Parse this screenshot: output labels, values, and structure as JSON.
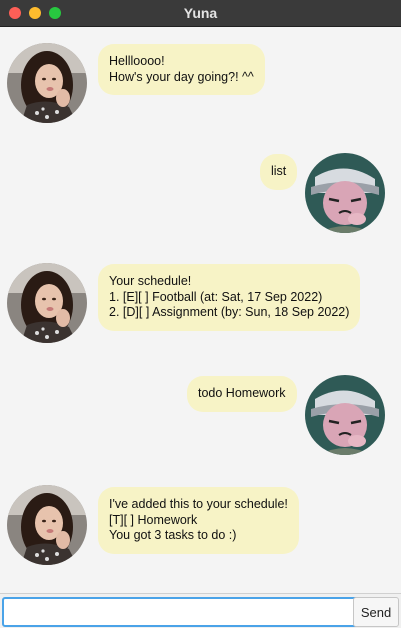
{
  "window": {
    "title": "Yuna"
  },
  "messages": [
    {
      "sender": "yuna",
      "lines": [
        "Hellloooo!",
        "How's your day going?! ^^"
      ]
    },
    {
      "sender": "user",
      "lines": [
        "list"
      ]
    },
    {
      "sender": "yuna",
      "lines": [
        "Your schedule!",
        "1. [E][ ] Football (at: Sat, 17 Sep 2022)",
        "2. [D][ ] Assignment (by: Sun, 18 Sep 2022)"
      ]
    },
    {
      "sender": "user",
      "lines": [
        "todo Homework"
      ]
    },
    {
      "sender": "yuna",
      "lines": [
        "I've added this to your schedule!",
        "[T][ ] Homework",
        "You got 3 tasks to do :)"
      ]
    }
  ],
  "input": {
    "value": "",
    "placeholder": ""
  },
  "send_label": "Send",
  "colors": {
    "bubble": "#f7f3c6",
    "chat_background": "#f4f4f4",
    "titlebar": "#3a3a3a",
    "input_border": "#4aa3e8"
  }
}
